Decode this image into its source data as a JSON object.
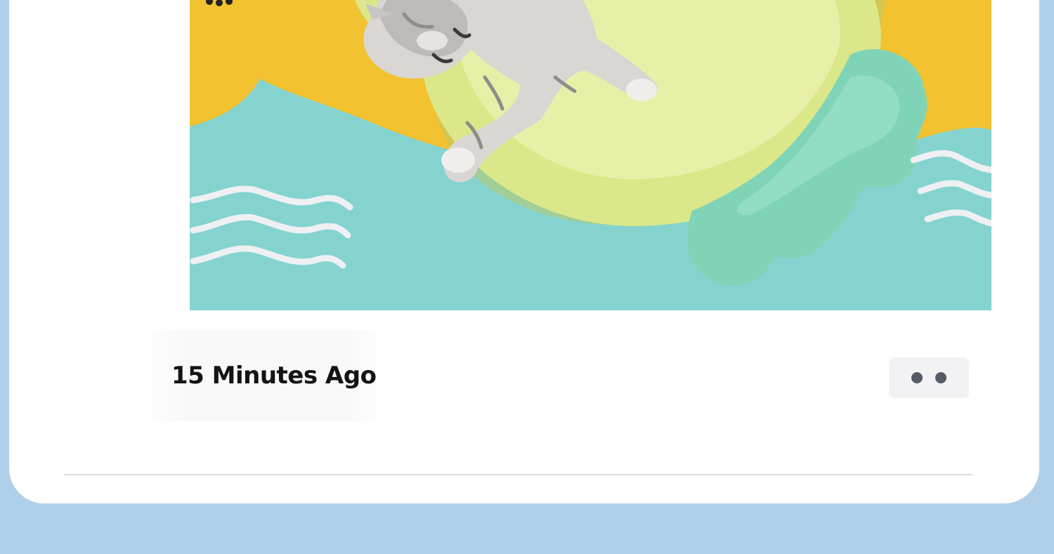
{
  "post": {
    "image": {
      "subject": "cat-on-cooling-mat-photo",
      "colors": {
        "background_yellow": "#f2c230",
        "water_teal": "#84d3cf",
        "mat_lime": "#dbe889",
        "mat_mint": "#7fd4b8",
        "wave_white": "#eef0f3",
        "page_background": "#b0cfe9"
      }
    },
    "timestamp": "15 Minutes Ago",
    "more_options_icon": "ellipsis-icon"
  }
}
